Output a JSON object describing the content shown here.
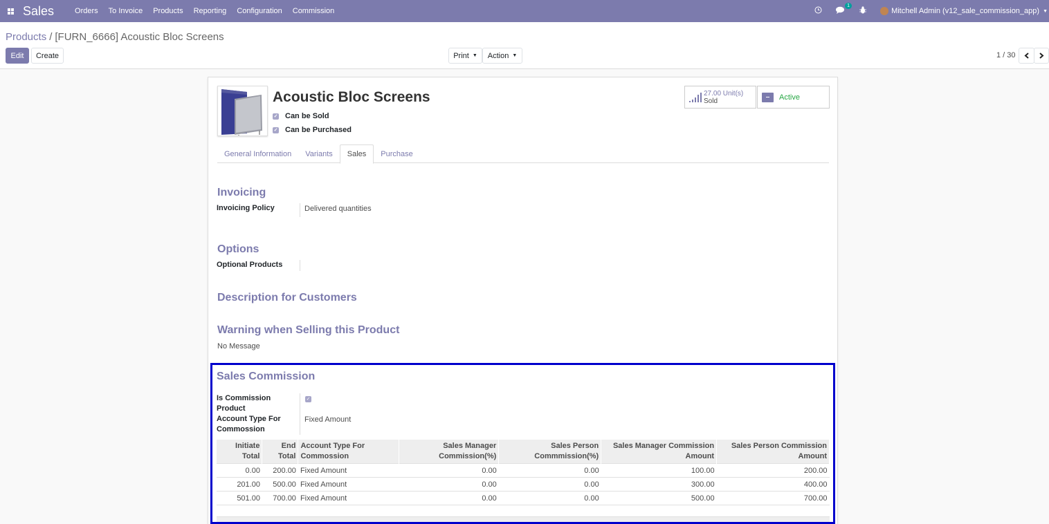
{
  "navbar": {
    "app_name": "Sales",
    "menu": [
      "Orders",
      "To Invoice",
      "Products",
      "Reporting",
      "Configuration",
      "Commission"
    ],
    "chat_count": "1",
    "user": "Mitchell Admin (v12_sale_commission_app)"
  },
  "breadcrumb": {
    "parent": "Products",
    "separator": "/",
    "current": "[FURN_6666] Acoustic Bloc Screens"
  },
  "actions": {
    "edit": "Edit",
    "create": "Create",
    "print": "Print",
    "action": "Action"
  },
  "pager": {
    "value": "1 / 30"
  },
  "product": {
    "name": "Acoustic Bloc Screens",
    "can_be_sold": "Can be Sold",
    "can_be_purchased": "Can be Purchased",
    "sold_units": "27.00 Unit(s)",
    "sold_label": "Sold",
    "status": "Active"
  },
  "tabs": [
    "General Information",
    "Variants",
    "Sales",
    "Purchase"
  ],
  "active_tab": "Sales",
  "sales_tab": {
    "invoicing_title": "Invoicing",
    "invoicing_policy_label": "Invoicing Policy",
    "invoicing_policy_value": "Delivered quantities",
    "options_title": "Options",
    "optional_products_label": "Optional Products",
    "description_title": "Description for Customers",
    "warning_title": "Warning when Selling this Product",
    "warning_value": "No Message"
  },
  "commission": {
    "title": "Sales Commission",
    "is_commission_label_1": "Is Commission",
    "is_commission_label_2": "Product",
    "account_type_label_1": "Account Type For",
    "account_type_label_2": "Commossion",
    "account_type_value": "Fixed Amount",
    "columns": [
      [
        "Initiate",
        "Total"
      ],
      [
        "End",
        "Total"
      ],
      [
        "Account Type For",
        "Commossion"
      ],
      [
        "Sales Manager",
        "Commission(%)"
      ],
      [
        "Sales Person",
        "Commmission(%)"
      ],
      [
        "Sales Manager Commission",
        "Amount"
      ],
      [
        "Sales Person Commission",
        "Amount"
      ]
    ],
    "rows": [
      [
        "0.00",
        "200.00",
        "Fixed Amount",
        "0.00",
        "0.00",
        "100.00",
        "200.00"
      ],
      [
        "201.00",
        "500.00",
        "Fixed Amount",
        "0.00",
        "0.00",
        "300.00",
        "400.00"
      ],
      [
        "501.00",
        "700.00",
        "Fixed Amount",
        "0.00",
        "0.00",
        "500.00",
        "700.00"
      ]
    ]
  },
  "colors": {
    "brand": "#7c7bad",
    "active_status": "#28a745",
    "highlight_border": "#0000cc"
  },
  "icons": [
    "apps-icon",
    "clock-icon",
    "chat-icon",
    "bug-icon",
    "bar-chart-icon",
    "archive-icon",
    "chevron-left-icon",
    "chevron-right-icon"
  ]
}
